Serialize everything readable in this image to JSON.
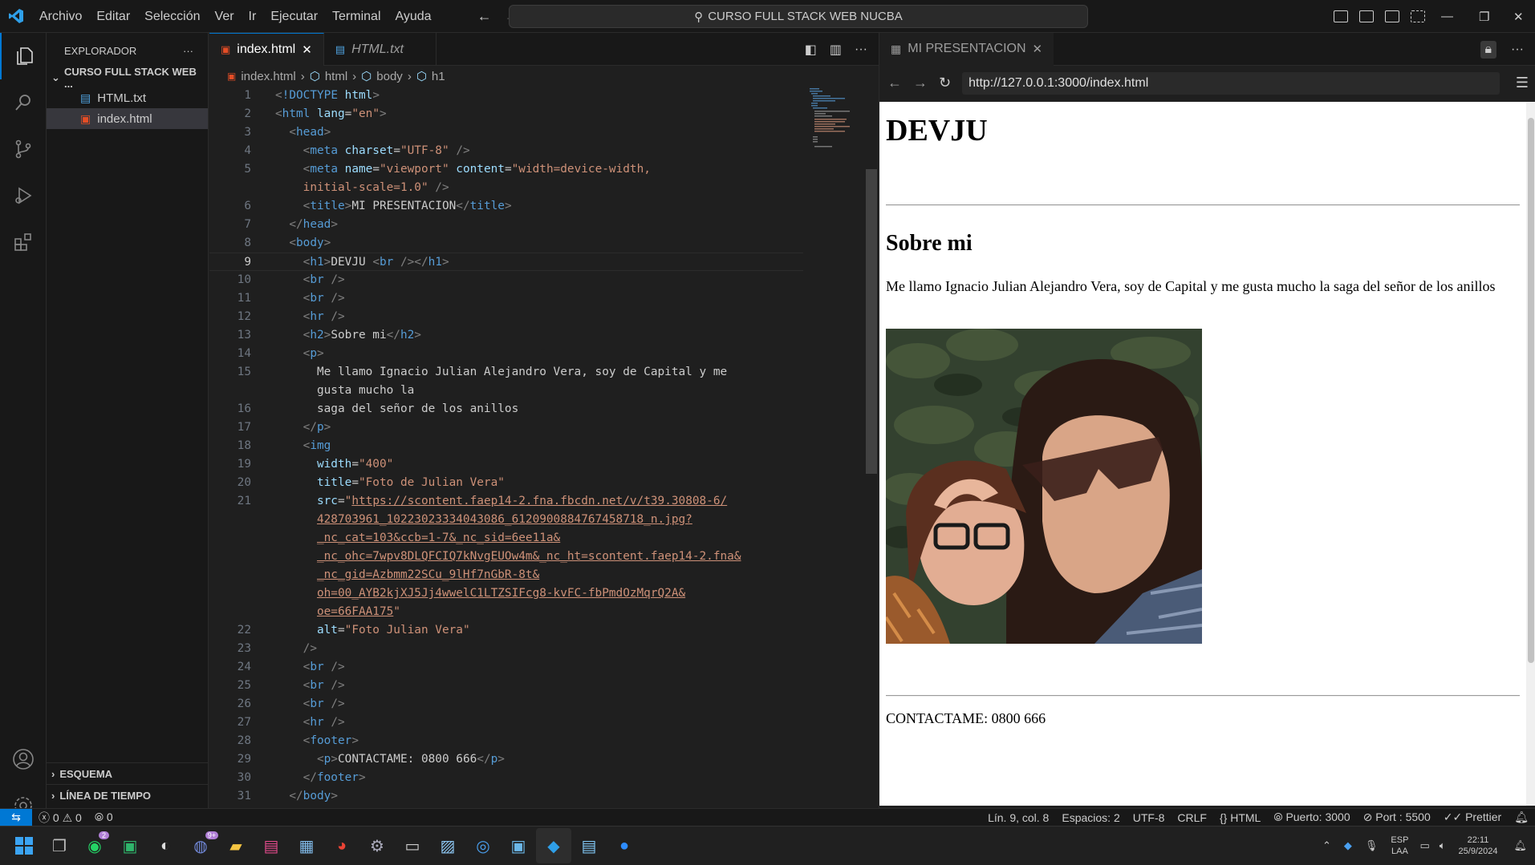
{
  "titlebar": {
    "menu": [
      "Archivo",
      "Editar",
      "Selección",
      "Ver",
      "Ir",
      "Ejecutar",
      "Terminal",
      "Ayuda"
    ],
    "search": "CURSO FULL STACK WEB NUCBA"
  },
  "sidebar": {
    "title": "EXPLORADOR",
    "folder": "CURSO FULL STACK WEB ...",
    "files": [
      "HTML.txt",
      "index.html"
    ],
    "outline": "ESQUEMA",
    "timeline": "LÍNEA DE TIEMPO"
  },
  "editor": {
    "tabs": [
      "index.html",
      "HTML.txt"
    ],
    "breadcrumb": [
      "index.html",
      "html",
      "body",
      "h1"
    ]
  },
  "preview": {
    "tab": "MI PRESENTACION",
    "url": "http://127.0.0.1:3000/index.html",
    "h1": "DEVJU",
    "h2": "Sobre mi",
    "paragraph": "Me llamo Ignacio Julian Alejandro Vera, soy de Capital y me gusta mucho la saga del señor de los anillos",
    "footer": "CONTACTAME: 0800 666"
  },
  "statusbar": {
    "errors": "0",
    "warnings": "0",
    "ports": "0",
    "position": "Lín. 9, col. 8",
    "spaces": "Espacios: 2",
    "encoding": "UTF-8",
    "eol": "CRLF",
    "language": "HTML",
    "port1": "Puerto: 3000",
    "port2": "Port : 5500",
    "prettier": "Prettier"
  },
  "taskbar": {
    "lang": "ESP",
    "lang2": "LAA",
    "time": "22:11",
    "date": "25/9/2024",
    "badge_whatsapp": "2",
    "badge_discord": "9+"
  },
  "colors": {
    "accent": "#0078d4",
    "tag": "#569cd6",
    "attr": "#9cdcfe",
    "string": "#ce9178"
  }
}
